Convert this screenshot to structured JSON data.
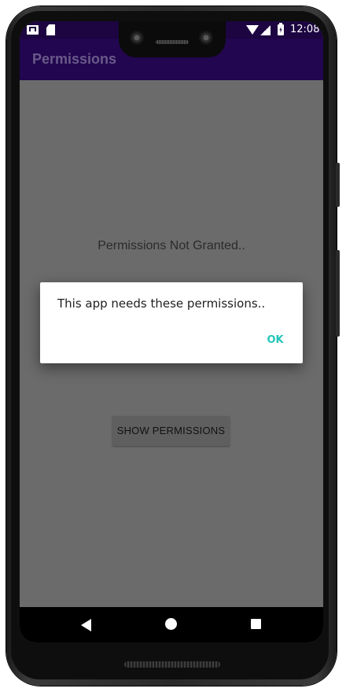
{
  "status_bar": {
    "time": "12:08",
    "left_icons": [
      "mail-icon",
      "sd-card-icon"
    ],
    "right_icons": [
      "wifi-icon",
      "signal-icon",
      "battery-charging-icon"
    ]
  },
  "app_bar": {
    "title": "Permissions",
    "color": "#22064f"
  },
  "main": {
    "status_text": "Permissions Not Granted..",
    "show_button_label": "SHOW PERMISSIONS"
  },
  "dialog": {
    "message": "This app needs these permissions..",
    "ok_label": "OK",
    "ok_color": "#25c5b8"
  },
  "nav_bar": {
    "icons": [
      "back-icon",
      "home-icon",
      "recents-icon"
    ]
  }
}
